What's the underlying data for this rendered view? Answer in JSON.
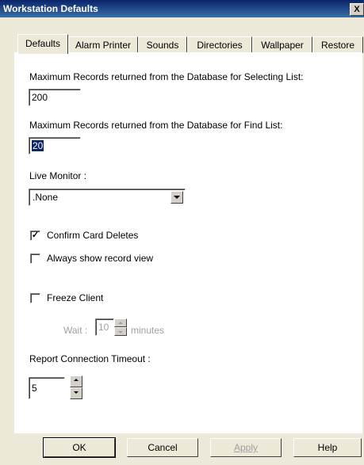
{
  "window": {
    "title": "Workstation Defaults",
    "close_label": "X"
  },
  "tabs": [
    {
      "label": "Defaults",
      "active": true
    },
    {
      "label": "Alarm Printer"
    },
    {
      "label": "Sounds"
    },
    {
      "label": "Directories"
    },
    {
      "label": "Wallpaper"
    },
    {
      "label": "Restore"
    }
  ],
  "defaults": {
    "max_selecting_label": "Maximum Records returned from the Database for Selecting List:",
    "max_selecting_value": "200",
    "max_find_label": "Maximum Records returned from the Database for Find List:",
    "max_find_value": "20",
    "live_monitor_label": "Live Monitor :",
    "live_monitor_value": ".None",
    "confirm_card_deletes_label": "Confirm Card Deletes",
    "confirm_card_deletes_checked": true,
    "always_show_record_view_label": "Always show record view",
    "always_show_record_view_checked": false,
    "freeze_client_label": "Freeze Client",
    "freeze_client_checked": false,
    "wait_label": "Wait :",
    "wait_value": "10",
    "minutes_label": "minutes",
    "report_timeout_label": "Report Connection Timeout :",
    "report_timeout_value": "5"
  },
  "buttons": {
    "ok": "OK",
    "cancel": "Cancel",
    "apply": "Apply",
    "help": "Help"
  }
}
